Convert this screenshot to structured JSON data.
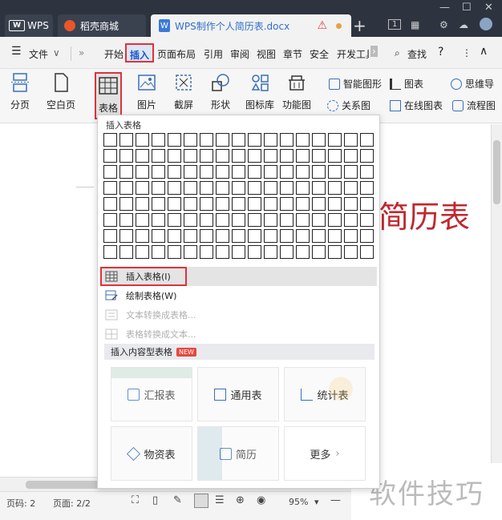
{
  "titlebar": {
    "wps_tab": "WPS",
    "store_tab": "稻壳商城",
    "doc_tab": "WPS制作个人简历表.docx",
    "page_badge": "1"
  },
  "menu": {
    "file": "文件",
    "items": [
      "开始",
      "插入",
      "页面布局",
      "引用",
      "审阅",
      "视图",
      "章节",
      "安全",
      "开发工具"
    ],
    "search": "查找"
  },
  "ribbon": {
    "page_break": "分页",
    "blank_page": "空白页",
    "table": "表格",
    "picture": "图片",
    "screenshot": "截屏",
    "shape": "形状",
    "icon_lib": "图标库",
    "function_chart": "功能图",
    "smart_shape": "智能图形",
    "chart": "图表",
    "mind_map": "思维导",
    "relation_chart": "关系图",
    "online_chart": "在线图表",
    "flow_chart": "流程图"
  },
  "document": {
    "title_text": "简历表"
  },
  "dropdown": {
    "title": "插入表格",
    "grid_rows": 8,
    "grid_cols": 17,
    "items": {
      "insert_table": "插入表格(I)",
      "draw_table": "绘制表格(W)",
      "text_to_table": "文本转换成表格...",
      "table_to_text": "表格转换成文本..."
    },
    "section": "插入内容型表格",
    "new_badge": "NEW",
    "cards": {
      "report": "汇报表",
      "general": "通用表",
      "stats": "统计表",
      "materials": "物资表",
      "resume": "简历",
      "more": "更多"
    }
  },
  "status": {
    "page_no": "页码: 2",
    "page_count": "页面: 2/2",
    "zoom": "95%"
  },
  "watermark": "软件技巧",
  "colors": {
    "accent_red": "#e0313a",
    "title_red": "#c0282e",
    "active_blue": "#1a56c8"
  }
}
